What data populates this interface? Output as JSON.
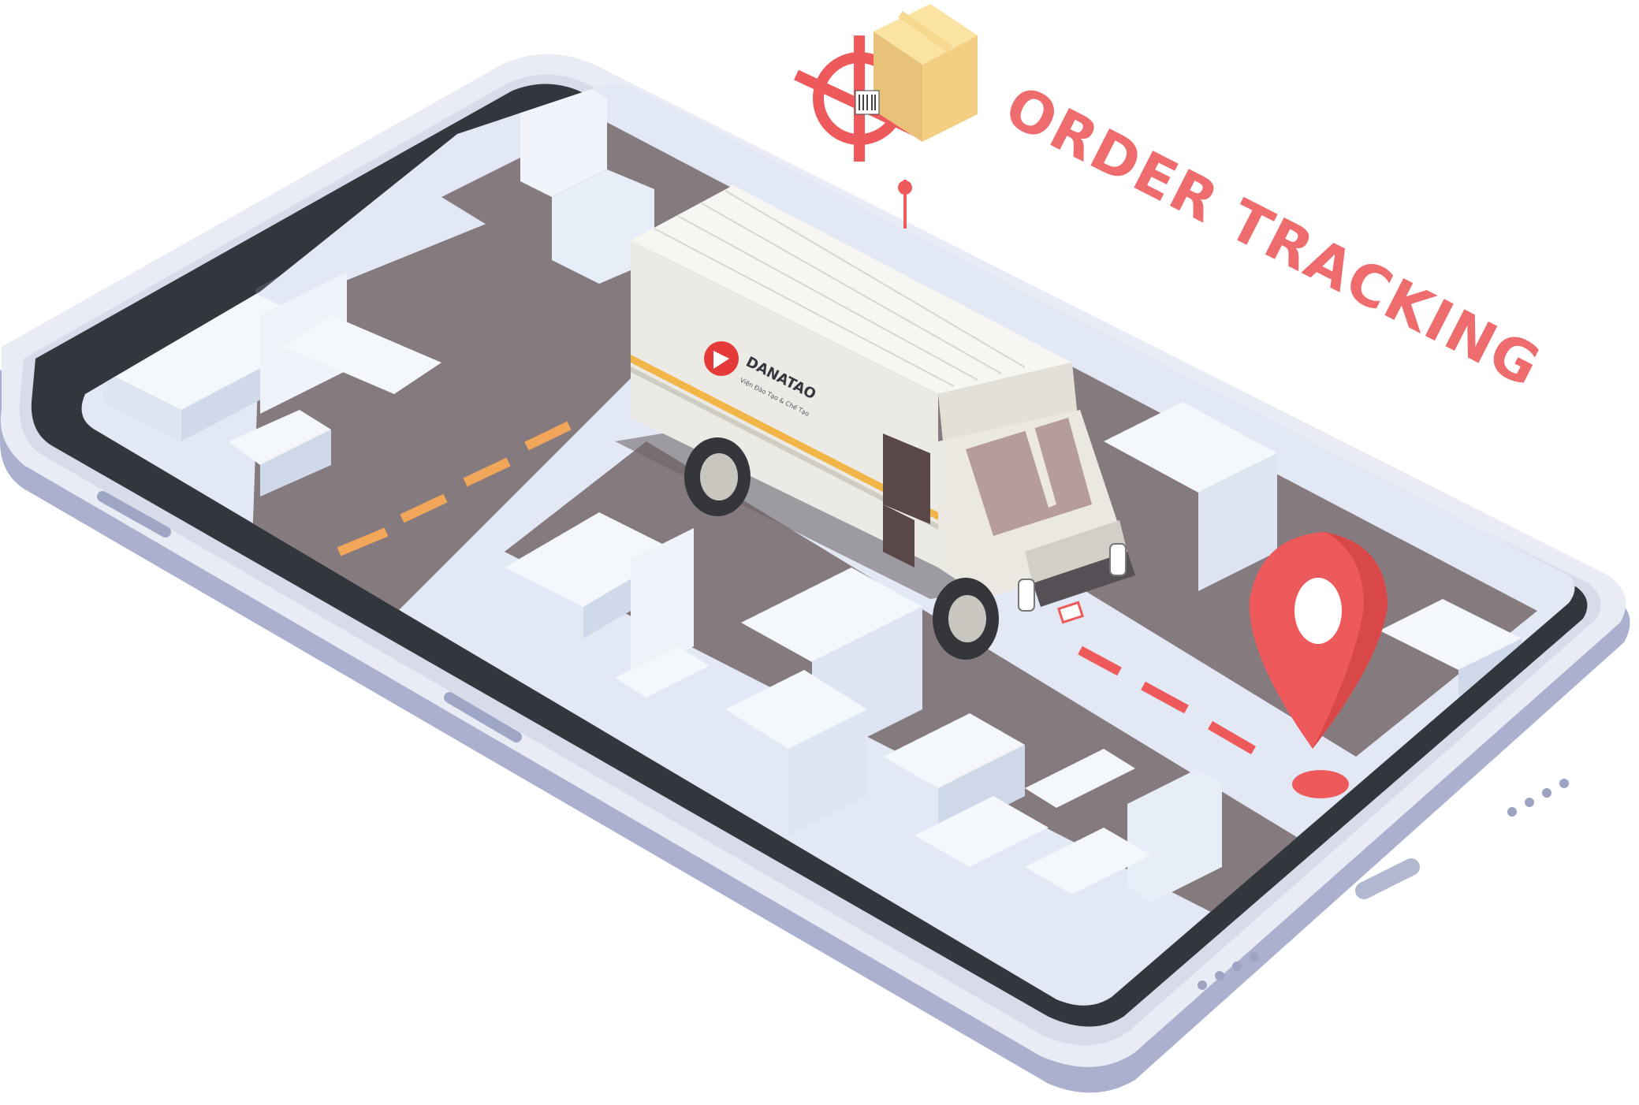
{
  "headline": "ORDER TRACKING",
  "van": {
    "brand_name": "DANATAO",
    "brand_tagline": "Viện Đào Tạo & Chế Tạo"
  },
  "icons": {
    "phone": "smartphone-icon",
    "van": "delivery-van-icon",
    "package": "cardboard-box-icon",
    "target": "crosshair-target-icon",
    "pin": "location-pin-icon",
    "logo": "danatao-logo-icon"
  },
  "colors": {
    "accent_red": "#ee5a5c",
    "road": "#857a7e",
    "road_dash_yellow": "#f2a65a",
    "road_dash_red": "#ee5a5c",
    "city_blocks": "#dfe7f3",
    "phone_frame": "#b7bdd6",
    "phone_bezel": "#32363d",
    "van_body": "#eceae4",
    "box": "#f0c777"
  }
}
